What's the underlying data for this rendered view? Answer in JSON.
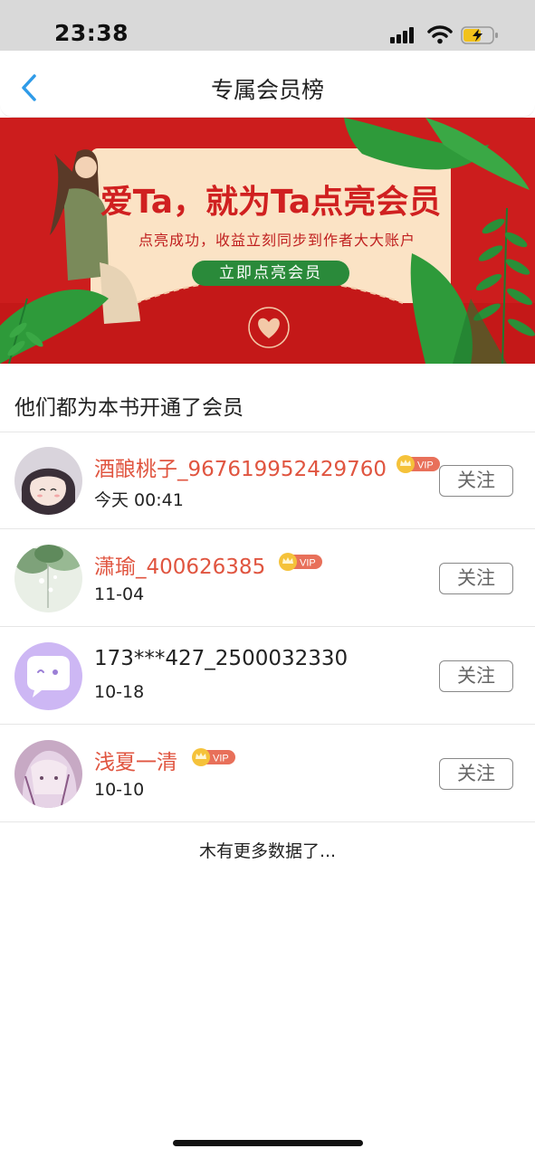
{
  "status_bar": {
    "time": "23:38"
  },
  "nav": {
    "title": "专属会员榜"
  },
  "banner": {
    "title": "爱Ta，就为Ta点亮会员",
    "subtitle": "点亮成功，收益立刻同步到作者大大账户",
    "button_label": "立即点亮会员"
  },
  "section": {
    "title": "他们都为本书开通了会员"
  },
  "members": [
    {
      "name": "酒酿桃子_967619952429760",
      "date": "今天 00:41",
      "vip": true,
      "follow_label": "关注"
    },
    {
      "name": "潇瑜_400626385",
      "date": "11-04",
      "vip": true,
      "follow_label": "关注"
    },
    {
      "name": "173***427_2500032330",
      "date": "10-18",
      "vip": false,
      "follow_label": "关注"
    },
    {
      "name": "浅夏一清",
      "date": "10-10",
      "vip": true,
      "follow_label": "关注"
    }
  ],
  "vip_badge_text": "VIP",
  "footer": {
    "no_more": "木有更多数据了..."
  },
  "colors": {
    "vip_name": "#e05540",
    "banner_red": "#cc1d1d",
    "accent_blue": "#2f9be8",
    "button_green": "#2a8a3a"
  }
}
